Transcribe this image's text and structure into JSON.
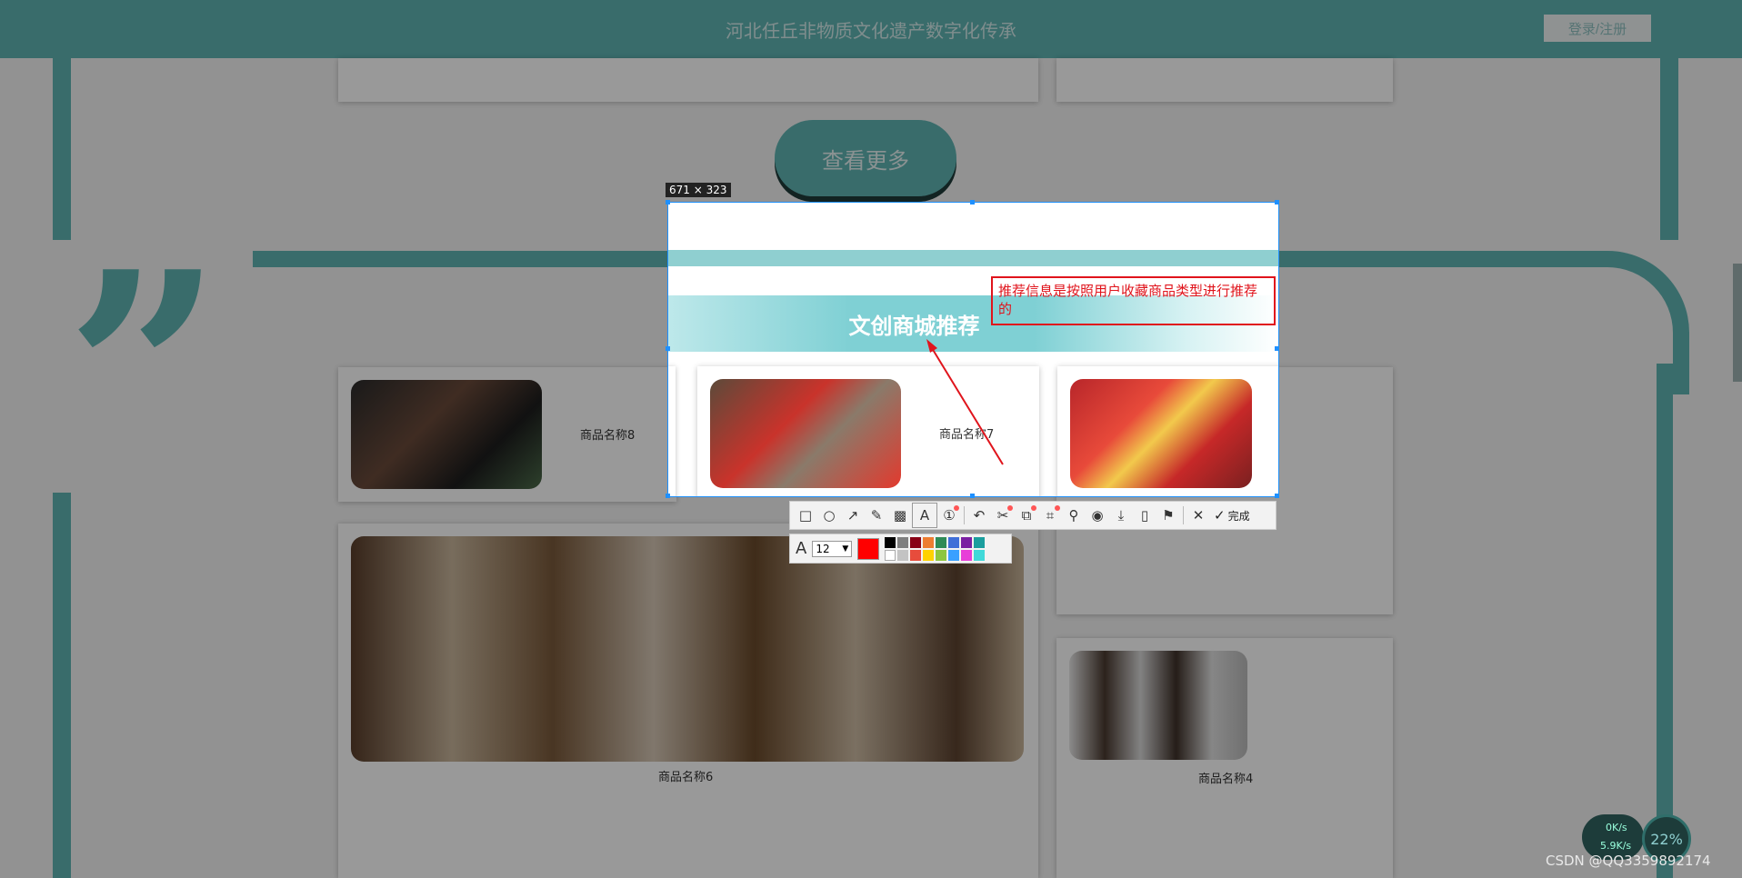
{
  "header": {
    "title": "河北任丘非物质文化遗产数字化传承",
    "login_label": "登录/注册"
  },
  "main": {
    "more_label": "查看更多",
    "products": [
      {
        "name": "商品名称8"
      },
      {
        "name": "商品名称7"
      },
      {
        "name": "商品名称6"
      },
      {
        "name": "商品名称4"
      }
    ]
  },
  "screenshot_tool": {
    "size_label": "671 × 323",
    "section_title": "文创商城推荐",
    "annotation_text": "推荐信息是按照用户收藏商品类型进行推荐的",
    "done_label": "完成",
    "font_size": "12",
    "current_color": "#ff0000",
    "tools": [
      "rect-icon",
      "ellipse-icon",
      "arrow-icon",
      "pencil-icon",
      "mosaic-icon",
      "text-icon",
      "number-icon",
      "undo-icon",
      "scissors-icon",
      "translate-icon",
      "ocr-icon",
      "pin-icon",
      "record-icon",
      "download-icon",
      "phone-icon",
      "bookmark-icon",
      "close-icon",
      "check-icon"
    ],
    "palette": [
      "#000000",
      "#7f7f7f",
      "#880015",
      "#ed7d31",
      "#2e8b57",
      "#3f6fd8",
      "#7a1fa2",
      "#1a9e9e",
      "#ffffff",
      "#c3c3c3",
      "#e74c3c",
      "#ffd200",
      "#8dc63f",
      "#3aa0ff",
      "#e83ed8",
      "#41d9d9"
    ]
  },
  "widget": {
    "speed_up": "0K/s",
    "speed_down": "5.9K/s",
    "percent": "22%"
  },
  "watermark": "CSDN @QQ3359892174",
  "colors": {
    "accent": "#5fb4b3",
    "annotation": "#e0141c",
    "selection": "#1e90ff"
  }
}
